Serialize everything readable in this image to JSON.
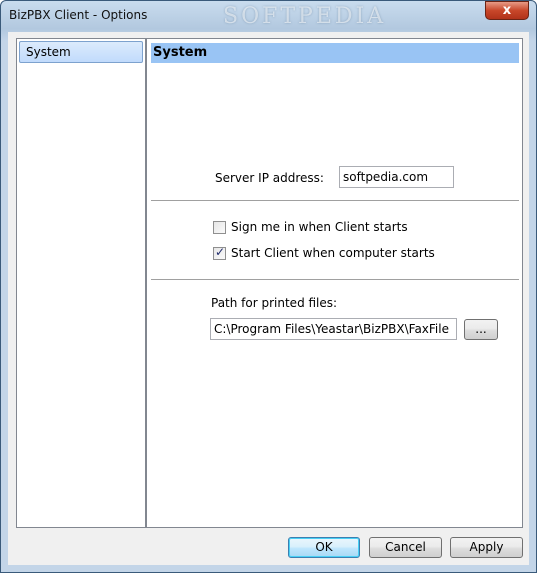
{
  "window": {
    "title": "BizPBX Client - Options",
    "watermark": "SOFTPEDIA",
    "close_label": "x"
  },
  "nav": {
    "items": [
      {
        "label": "System",
        "selected": true
      }
    ]
  },
  "panel": {
    "title": "System",
    "server_ip_label": "Server IP address:",
    "server_ip_value": "softpedia.com",
    "sign_in_label": "Sign me in when Client starts",
    "sign_in_checked": false,
    "start_client_label": "Start Client when computer starts",
    "start_client_checked": true,
    "path_label": "Path for printed files:",
    "path_value": "C:\\Program Files\\Yeastar\\BizPBX\\FaxFile",
    "browse_label": "..."
  },
  "buttons": {
    "ok": "OK",
    "cancel": "Cancel",
    "apply": "Apply"
  },
  "colors": {
    "selection": "#c1dbfc",
    "header": "#99c4f4",
    "close": "#c8472a"
  }
}
